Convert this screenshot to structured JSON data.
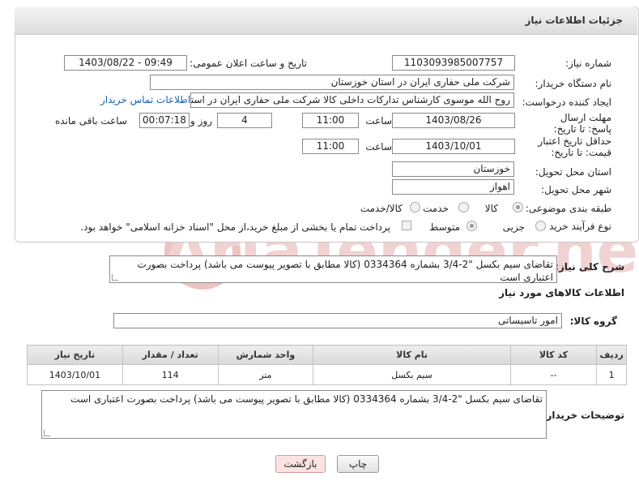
{
  "header": {
    "title": "جزئیات اطلاعات نیاز"
  },
  "need_number": {
    "label": "شماره نیاز:",
    "value": "1103093985007757"
  },
  "announce": {
    "label": "تاریخ و ساعت اعلان عمومی:",
    "value": "1403/08/22 - 09:49"
  },
  "buyer_org": {
    "label": "نام دستگاه خریدار:",
    "value": "شرکت ملی حفاری ایران در استان خوزستان"
  },
  "creator": {
    "label": "ایجاد کننده درخواست:",
    "value": "روح الله موسوی کارشناس تدارکات داخلی کالا شرکت ملی حفاری ایران در استان",
    "contact_link": "اطلاعات تماس خریدار"
  },
  "reply_deadline": {
    "label": "مهلت ارسال پاسخ: تا تاریخ:",
    "date": "1403/08/26",
    "time_label": "ساعت",
    "time": "11:00",
    "days": "4",
    "days_label": "روز و",
    "remaining": "00:07:18",
    "remaining_label": "ساعت باقی مانده"
  },
  "price_validity": {
    "label": "حداقل تاریخ اعتبار قیمت: تا تاریخ:",
    "date": "1403/10/01",
    "time_label": "ساعت",
    "time": "11:00"
  },
  "province": {
    "label": "استان محل تحویل:",
    "value": "خوزستان"
  },
  "city": {
    "label": "شهر محل تحویل:",
    "value": "اهواز"
  },
  "category": {
    "label": "طبقه بندی موضوعی:",
    "options": [
      "کالا",
      "خدمت",
      "کالا/خدمت"
    ]
  },
  "process": {
    "label": "نوع فرآیند خرید :",
    "options": [
      "جزیی",
      "متوسط"
    ],
    "payment_note": "پرداخت تمام یا بخشی از مبلغ خرید،از محل \"اسناد خزانه اسلامی\" خواهد بود."
  },
  "description": {
    "label": "شرح کلی نیاز:",
    "value": "تقاضای سیم بکسل \"2-3/4  بشماره 0334364 (کالا مطابق با تصویر پیوست می باشد) پرداخت بصورت اعتباری است"
  },
  "goods_section": {
    "title": "اطلاعات کالاهای مورد نیاز"
  },
  "goods_group": {
    "label": "گروه کالا:",
    "value": "امور تاسیساتی"
  },
  "table": {
    "headers": [
      "ردیف",
      "کد کالا",
      "نام کالا",
      "واحد شمارش",
      "تعداد / مقدار",
      "تاریخ نیاز"
    ],
    "rows": [
      [
        "1",
        "--",
        "سیم بکسل",
        "متر",
        "114",
        "1403/10/01"
      ]
    ]
  },
  "buyer_notes": {
    "label": "توضیحات خریدار:",
    "value": "تقاضای سیم بکسل \"2-3/4 بشماره 0334364 (کالا مطابق با تصویر پیوست می باشد) پرداخت بصورت اعتباری است"
  },
  "buttons": {
    "print": "چاپ",
    "back": "بازگشت"
  },
  "watermark": {
    "text": "AriaTender.neT"
  },
  "colors": {
    "link": "#1a5fb4",
    "back_button_bg": "#fbe3e3",
    "watermark": "#e6b3b3"
  }
}
